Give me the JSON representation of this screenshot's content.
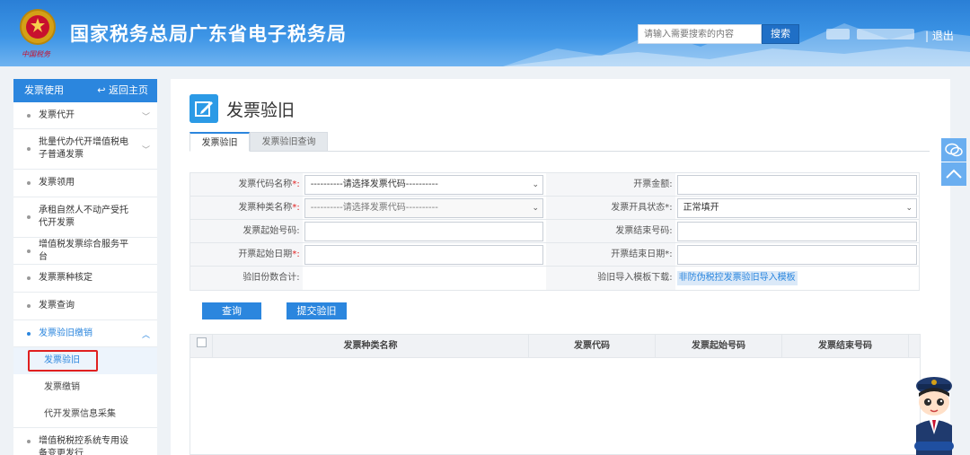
{
  "header": {
    "title": "国家税务总局广东省电子税务局",
    "search_placeholder": "请输入需要搜索的内容",
    "search_button": "搜索",
    "logout": "| 退出",
    "emblem_text": "中国税务"
  },
  "sidebar": {
    "title": "发票使用",
    "home_link": "返回主页",
    "items": [
      {
        "label": "发票代开"
      },
      {
        "label": "批量代办代开增值税电子普通发票"
      },
      {
        "label": "发票领用"
      },
      {
        "label": "承租自然人不动产受托代开发票"
      },
      {
        "label": "增值税发票综合服务平台"
      },
      {
        "label": "发票票种核定"
      },
      {
        "label": "发票查询"
      },
      {
        "label": "发票验旧缴销"
      },
      {
        "label": "增值税税控系统专用设备变更发行"
      }
    ],
    "sub_items": [
      {
        "label": "发票验旧"
      },
      {
        "label": "发票缴销"
      },
      {
        "label": "代开发票信息采集"
      }
    ]
  },
  "main": {
    "page_title": "发票验旧",
    "tabs": [
      {
        "label": "发票验旧"
      },
      {
        "label": "发票验旧查询"
      }
    ],
    "form": {
      "invoice_code_name_label": "发票代码名称",
      "invoice_code_name_value": "----------请选择发票代码----------",
      "invoice_amount_label": "开票金额:",
      "invoice_type_name_label": "发票种类名称",
      "invoice_type_name_value": "----------请选择发票代码----------",
      "issue_status_label": "发票开具状态",
      "issue_status_value": "正常填开",
      "start_number_label": "发票起始号码:",
      "end_number_label": "发票结束号码:",
      "start_date_label": "开票起始日期",
      "end_date_label": "开票结束日期",
      "total_copies_label": "验旧份数合计:",
      "template_label": "验旧导入模板下载:",
      "template_link": "非防伪税控发票验旧导入模板",
      "required_mark": "*:"
    },
    "buttons": {
      "query": "查询",
      "submit": "提交验旧"
    },
    "grid_headers": [
      "发票种类名称",
      "发票代码",
      "发票起始号码",
      "发票结束号码"
    ]
  },
  "colors": {
    "brand_blue": "#2b86de",
    "required_red": "#e02020"
  }
}
